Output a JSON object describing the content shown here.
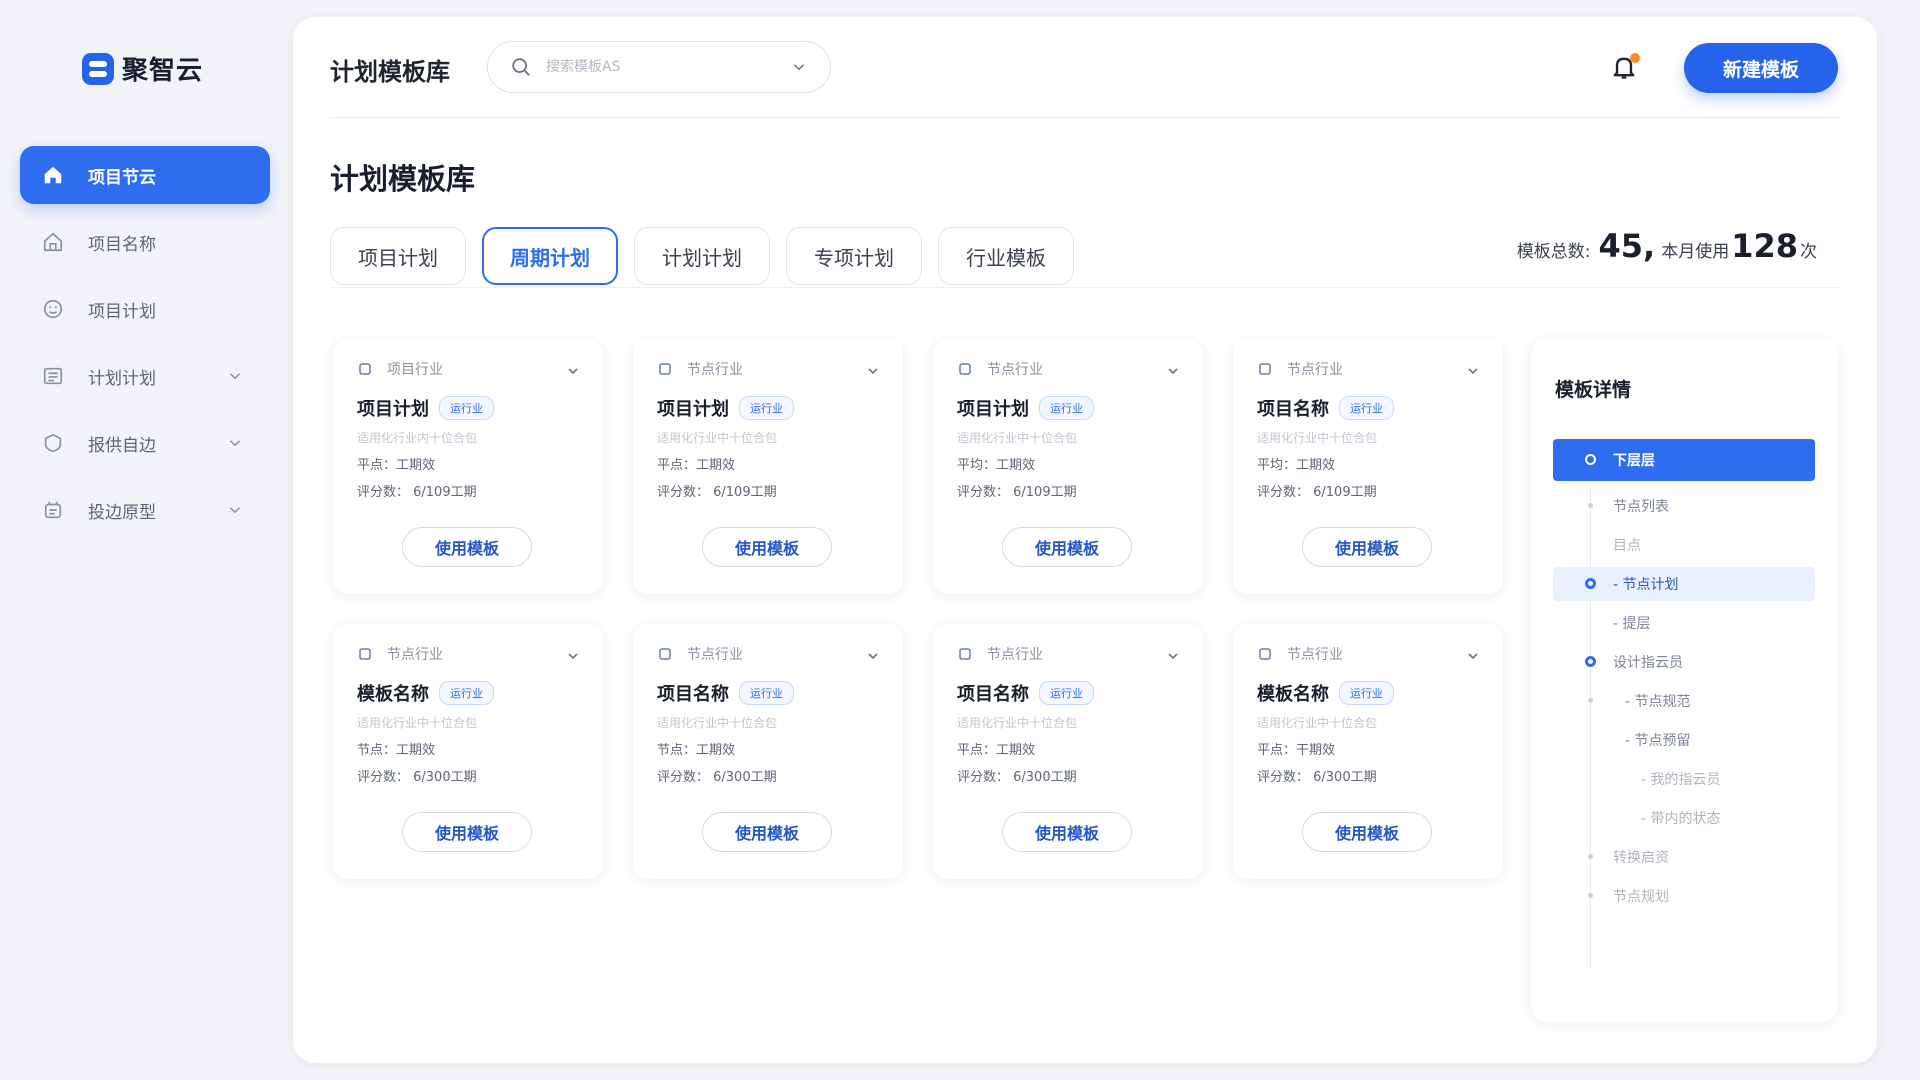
{
  "app": {
    "logo_text": "聚智云"
  },
  "sidebar": {
    "items": [
      {
        "label": "项目节云",
        "icon": "home-icon"
      },
      {
        "label": "项目名称",
        "icon": "house-outline-icon"
      },
      {
        "label": "项目计划",
        "icon": "face-icon"
      },
      {
        "label": "计划计划",
        "icon": "list-icon"
      },
      {
        "label": "报供自边",
        "icon": "shield-icon"
      },
      {
        "label": "投边原型",
        "icon": "box-icon"
      }
    ]
  },
  "header": {
    "title": "计划模板库",
    "search_placeholder": "搜索模板AS",
    "new_button": "新建模板"
  },
  "page": {
    "title": "计划模板库",
    "tabs": [
      "项目计划",
      "周期计划",
      "计划计划",
      "专项计划",
      "行业模板"
    ],
    "stats": {
      "total_label": "模板总数:",
      "total_value": "45,",
      "month_label": "本月使用",
      "month_value": "128",
      "month_unit": "次"
    }
  },
  "cards": [
    {
      "category": "项目行业",
      "title": "项目计划",
      "badge": "运行业",
      "desc": "适用化行业内十位合包",
      "line1": "平点：工期效",
      "line2": "评分数：  6/109工期",
      "button": "使用模板"
    },
    {
      "category": "节点行业",
      "title": "项目计划",
      "badge": "运行业",
      "desc": "适用化行业中十位合包",
      "line1": "平点：工期效",
      "line2": "评分数：  6/109工期",
      "button": "使用模板"
    },
    {
      "category": "节点行业",
      "title": "项目计划",
      "badge": "运行业",
      "desc": "适用化行业中十位合包",
      "line1": "平均：工期效",
      "line2": "评分数：  6/109工期",
      "button": "使用模板"
    },
    {
      "category": "节点行业",
      "title": "项目名称",
      "badge": "运行业",
      "desc": "适用化行业中十位合包",
      "line1": "平均：工期效",
      "line2": "评分数：  6/109工期",
      "button": "使用模板"
    },
    {
      "category": "节点行业",
      "title": "模板名称",
      "badge": "运行业",
      "desc": "适用化行业中十位合包",
      "line1": "节点：工期效",
      "line2": "评分数：  6/300工期",
      "button": "使用模板"
    },
    {
      "category": "节点行业",
      "title": "项目名称",
      "badge": "运行业",
      "desc": "适用化行业中十位合包",
      "line1": "节点：工期效",
      "line2": "评分数：  6/300工期",
      "button": "使用模板"
    },
    {
      "category": "节点行业",
      "title": "项目名称",
      "badge": "运行业",
      "desc": "适用化行业中十位合包",
      "line1": "平点：工期效",
      "line2": "评分数：  6/300工期",
      "button": "使用模板"
    },
    {
      "category": "节点行业",
      "title": "模板名称",
      "badge": "运行业",
      "desc": "适用化行业中十位合包",
      "line1": "平点：干期效",
      "line2": "评分数：  6/300工期",
      "button": "使用模板"
    }
  ],
  "detail": {
    "title": "模板详情",
    "tree": [
      {
        "label": "下层层",
        "state": "selected"
      },
      {
        "label": "节点列表",
        "state": "normal"
      },
      {
        "label": "目点",
        "state": "faint"
      },
      {
        "label": "- 节点计划",
        "state": "highlight"
      },
      {
        "label": "- 提层",
        "state": "normal"
      },
      {
        "label": "设计指云员",
        "state": "normal"
      },
      {
        "label": "- 节点规范",
        "state": "normal"
      },
      {
        "label": "- 节点预留",
        "state": "normal"
      },
      {
        "label": "- 我的指云员",
        "state": "faint"
      },
      {
        "label": "- 带内的状态",
        "state": "faint"
      },
      {
        "label": "转换启资",
        "state": "faint"
      },
      {
        "label": "节点规划",
        "state": "faint"
      }
    ]
  },
  "colors": {
    "accent": "#2f6df0",
    "notification": "#ff8a1f"
  }
}
